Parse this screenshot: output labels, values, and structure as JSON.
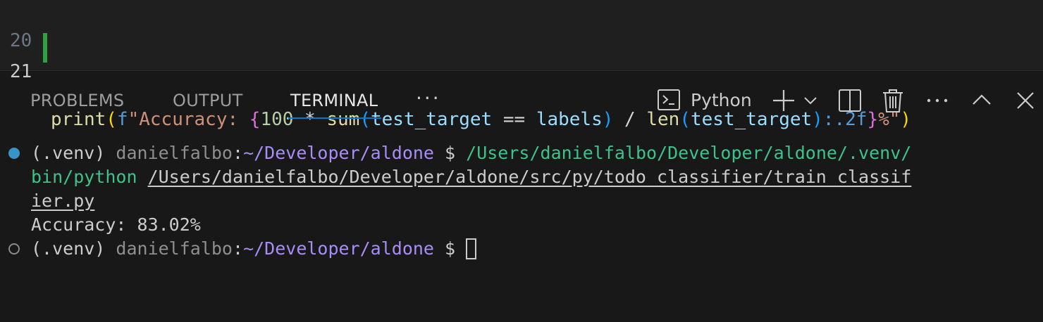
{
  "editor": {
    "line_numbers": [
      "20",
      "21"
    ],
    "line_21": {
      "fn_print": "print",
      "paren_open": "(",
      "f_prefix": "f",
      "str_open": "\"Accuracy: ",
      "brace_open": "{",
      "num": "100",
      "op_mul": " * ",
      "fn_sum": "sum",
      "sum_open": "(",
      "var_target1": "test_target",
      "op_eq": " == ",
      "var_labels": "labels",
      "sum_close": ")",
      "op_div": " / ",
      "fn_len": "len",
      "len_open": "(",
      "var_target2": "test_target",
      "len_close": ")",
      "fmt_spec": ":.2f",
      "brace_close": "}",
      "str_close": "%\"",
      "paren_close": ")"
    }
  },
  "panel": {
    "tabs": [
      "PROBLEMS",
      "OUTPUT",
      "TERMINAL"
    ],
    "active_tab": "TERMINAL",
    "more_label": "···",
    "terminal_name": "Python",
    "icons": [
      "terminal-icon",
      "add-icon",
      "chevron-down-icon",
      "split-icon",
      "trash-icon",
      "more-icon",
      "chevron-up-icon",
      "close-icon"
    ]
  },
  "terminal": {
    "line1": {
      "venv": "(.venv) ",
      "user": "danielfalbo",
      "sep": ":",
      "path": "~/Developer/aldone",
      "prompt": " $ ",
      "cmd": "/Users/danielfalbo/Developer/aldone/.venv/"
    },
    "line2": {
      "cmd": "bin/python",
      "space": " ",
      "script": "/Users/danielfalbo/Developer/aldone/src/py/todo_classifier/train_classif"
    },
    "line3": {
      "script": "ier.py"
    },
    "line4": {
      "output": "Accuracy: 83.02%"
    },
    "line5": {
      "venv": "(.venv) ",
      "user": "danielfalbo",
      "sep": ":",
      "path": "~/Developer/aldone",
      "prompt": " $ "
    }
  },
  "colors": {
    "background": "#181818",
    "editor_background": "#1f1f1f",
    "accent_tab_underline": "#0078d4",
    "git_added": "#2ea043",
    "path": "#a98df7",
    "command": "#3ec28b",
    "success_decoration": "#3794c8"
  }
}
